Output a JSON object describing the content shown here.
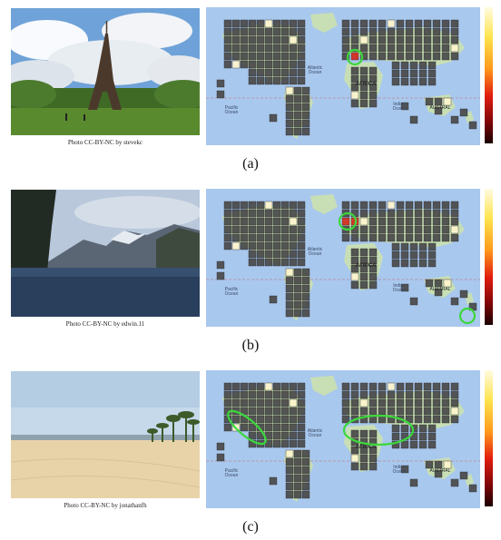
{
  "panels": [
    {
      "credit": "Photo CC-BY-NC by stevekc",
      "label": "(a)",
      "map_text": {
        "atlantic": "Atlantic\nOcean",
        "africa": "AFRICA",
        "indian": "Indian\nOcean",
        "pacific": "Pacific\nOcean",
        "australia": "AUSTRAL"
      },
      "highlight": "single cell in western Europe",
      "colors": {
        "sky": "#6fa2d8",
        "grass": "#5a8a2e"
      }
    },
    {
      "credit": "Photo CC-BY-NC by edwin.11",
      "label": "(b)",
      "map_text": {
        "atlantic": "Atlantic\nOcean",
        "africa": "AFRICA",
        "indian": "Indian\nOcean",
        "pacific": "Pacific\nOcean",
        "australia": "AUSTRAL"
      },
      "highlight": "cells in Scandinavia and New Zealand",
      "colors": {
        "sky": "#b9c8db",
        "water": "#2a3f5c"
      }
    },
    {
      "credit": "Photo CC-BY-NC by jonathanfh",
      "label": "(c)",
      "map_text": {
        "atlantic": "Atlantic\nOcean",
        "africa": "AFRICA",
        "indian": "Indian\nOcean",
        "pacific": "Pacific\nOcean",
        "australia": "AUSTRAL"
      },
      "highlight": "California coast and Mediterranean / North Africa",
      "colors": {
        "sky": "#c5d9ea",
        "sand": "#e8d3a9"
      }
    }
  ],
  "map_colors": {
    "ocean": "#a9c8ee",
    "land": "#c8dfb5",
    "cell": "#4a4a4a",
    "highlight": "#3cd73c"
  }
}
